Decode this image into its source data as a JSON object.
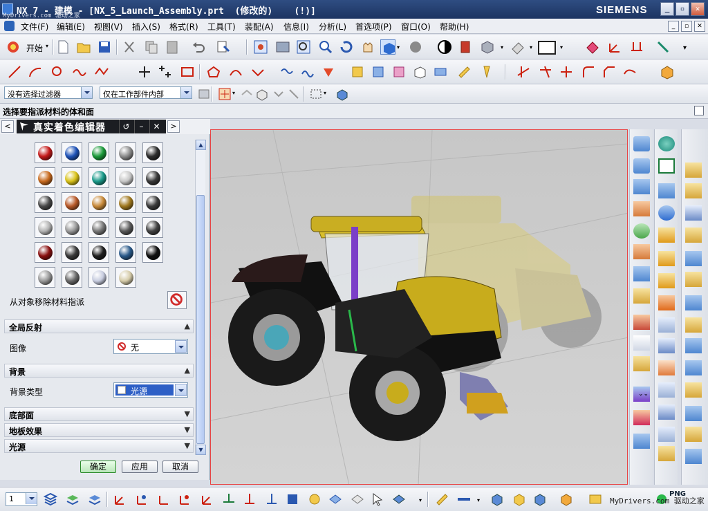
{
  "window": {
    "title": "NX 7 - 建模 - [NX_5_Launch_Assembly.prt  (修改的)    (!)]",
    "watermark": "MyDrivers.com 驱动之家",
    "brand": "SIEMENS",
    "controls": [
      "_",
      "▫",
      "✕"
    ]
  },
  "menu": {
    "items": [
      "文件(F)",
      "编辑(E)",
      "视图(V)",
      "插入(S)",
      "格式(R)",
      "工具(T)",
      "装配(A)",
      "信息(I)",
      "分析(L)",
      "首选项(P)",
      "窗口(O)",
      "帮助(H)"
    ],
    "start_label": "开始"
  },
  "selection_bar": {
    "filter": "没有选择过滤器",
    "scope": "仅在工作部件内部"
  },
  "cue_line": "选择要指派材料的体和面",
  "panel": {
    "title": "真实着色编辑器",
    "remove_label": "从对象移除材料指派",
    "global_reflection": "全局反射",
    "image_label": "图像",
    "image_value": "无",
    "background_section": "背景",
    "background_type_label": "背景类型",
    "background_type_value": "光源",
    "floor_section": "底部面",
    "floor_effect_section": "地板效果",
    "light_section": "光源",
    "ok": "确定",
    "apply": "应用",
    "cancel": "取消"
  },
  "materials": [
    [
      "#c41a1a",
      "#1f53b8",
      "#1b9a3a",
      "#8c8c8c",
      "#2e2e2e"
    ],
    [
      "#c86a1e",
      "#d9c21a",
      "#1a9a8a",
      "#c8c8c8",
      "#3a3a3a"
    ],
    [
      "#4a4a4a",
      "#b85a2a",
      "#c88a3a",
      "#a0781e",
      "#3c3c3c"
    ],
    [
      "#b4b4b4",
      "#9a9a9a",
      "#787878",
      "#5a5a5a",
      "#444444"
    ],
    [
      "#8a1010",
      "#3a3a3a",
      "#202020",
      "#2a5a8a",
      "#111111"
    ],
    [
      "#9a9a9a",
      "#6a6a6a",
      "#c8cde0",
      "#d6ccaa"
    ]
  ],
  "bottom": {
    "layer_value": "1",
    "watermark": "MyDrivers.com 驱动之家",
    "png_label": "PNG"
  }
}
